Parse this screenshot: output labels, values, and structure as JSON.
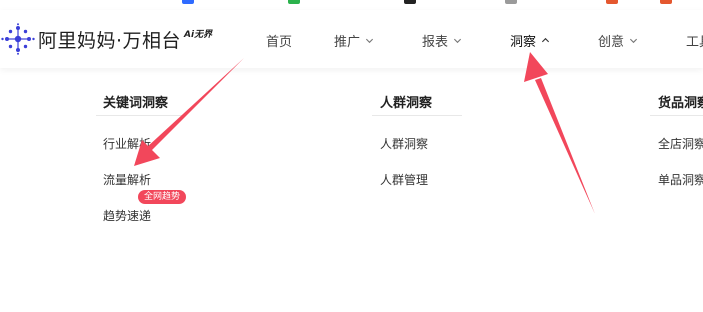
{
  "brand": {
    "name": "阿里妈妈·万相台",
    "badge": "Ai无界"
  },
  "nav": {
    "items": [
      {
        "label": "首页",
        "has_chevron": false,
        "active": false
      },
      {
        "label": "推广",
        "has_chevron": true,
        "active": false
      },
      {
        "label": "报表",
        "has_chevron": true,
        "active": false
      },
      {
        "label": "洞察",
        "has_chevron": true,
        "active": true,
        "expanded": true
      },
      {
        "label": "创意",
        "has_chevron": true,
        "active": false
      },
      {
        "label": "工具",
        "has_chevron": false,
        "active": false
      }
    ]
  },
  "dropdown": {
    "columns": [
      {
        "title": "关键词洞察",
        "links": [
          "行业解析",
          "流量解析",
          "趋势速递"
        ]
      },
      {
        "title": "人群洞察",
        "links": [
          "人群洞察",
          "人群管理"
        ]
      },
      {
        "title": "货品洞察",
        "links": [
          "全店洞察",
          "单品洞察"
        ]
      }
    ],
    "badge": "全网趋势"
  },
  "annotations": {
    "arrow_color": "#f2475b"
  },
  "colors": {
    "accent_red": "#f2475b",
    "logo_blue": "#3b3fd8"
  }
}
